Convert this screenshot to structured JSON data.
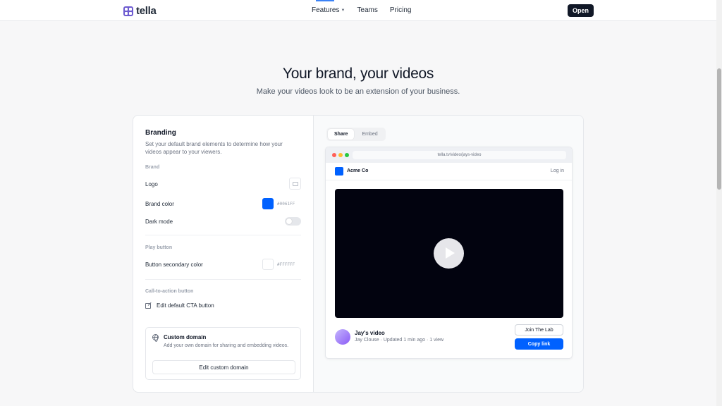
{
  "nav": {
    "brand": "tella",
    "links": [
      {
        "label": "Features",
        "has_dropdown": true
      },
      {
        "label": "Teams",
        "has_dropdown": false
      },
      {
        "label": "Pricing",
        "has_dropdown": false
      }
    ],
    "open_label": "Open"
  },
  "hero": {
    "title": "Your brand, your videos",
    "subtitle": "Make your videos look to be an extension of your business."
  },
  "branding": {
    "title": "Branding",
    "description": "Set your default brand elements to determine how your videos appear to your viewers.",
    "brand_section": "Brand",
    "logo_label": "Logo",
    "brand_color_label": "Brand color",
    "brand_color_hex": "#0061FF",
    "dark_mode_label": "Dark mode",
    "dark_mode_on": false,
    "play_section": "Play button",
    "secondary_color_label": "Button secondary color",
    "secondary_color_hex": "#FFFFFF",
    "cta_section": "Call-to-action button",
    "cta_edit_label": "Edit default CTA button",
    "domain_title": "Custom domain",
    "domain_desc": "Add your own domain for sharing and embedding videos.",
    "domain_button": "Edit custom domain"
  },
  "preview": {
    "tabs": [
      {
        "label": "Share",
        "active": true
      },
      {
        "label": "Embed",
        "active": false
      }
    ],
    "url": "tella.tv/video/jays-video",
    "site_name": "Acme Co",
    "login_label": "Log in",
    "video_title": "Jay's video",
    "video_meta": "Jay Clouse · Updated 1 min ago · 1 view",
    "join_label": "Join The Lab",
    "copy_label": "Copy link"
  },
  "colors": {
    "accent": "#0061ff",
    "dark": "#111827",
    "traffic_red": "#ff5f57",
    "traffic_yellow": "#febc2e",
    "traffic_green": "#28c840"
  }
}
